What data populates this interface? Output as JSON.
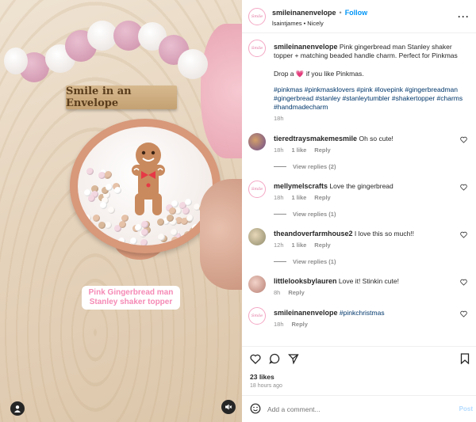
{
  "post": {
    "username": "smileinanenvelope",
    "follow_label": "Follow",
    "separator": "•",
    "audio": "lsaintjames • Nicely",
    "avatar_text": "Smile",
    "caption_intro": "Pink gingerbread man Stanley shaker topper + matching beaded handle charm. Perfect for Pinkmas",
    "caption_drop": "Drop a 💗 if you like Pinkmas.",
    "caption_tags": "#pinkmas #pinkmasklovers #pink #lovepink #gingerbreadman #gingerbread #stanley #stanleytumbler #shakertopper #charms #handmadecharm",
    "caption_time": "18h"
  },
  "media": {
    "plaque_text": "Smile in an Envelope",
    "overlay_caption": "Pink Gingerbread man Stanley shaker topper",
    "profile_icon": "person-icon",
    "mute_icon": "speaker-muted-icon"
  },
  "comments": [
    {
      "user": "tieredtraysmakemesmile",
      "text": "Oh so cute!",
      "time": "18h",
      "likes": "1 like",
      "reply": "Reply",
      "view_replies": "View replies (2)"
    },
    {
      "user": "mellymelscrafts",
      "text": "Love the gingerbread",
      "time": "18h",
      "likes": "1 like",
      "reply": "Reply",
      "view_replies": "View replies (1)"
    },
    {
      "user": "theandoverfarmhouse2",
      "text": "I love this so much!!",
      "time": "12h",
      "likes": "1 like",
      "reply": "Reply",
      "view_replies": "View replies (1)"
    },
    {
      "user": "littlelooksbylauren",
      "text": "Love it! Stinkin cute!",
      "time": "8h",
      "likes": "",
      "reply": "Reply",
      "view_replies": ""
    },
    {
      "user": "smileinanenvelope",
      "text": "#pinkchristmas",
      "time": "18h",
      "likes": "",
      "reply": "Reply",
      "view_replies": ""
    }
  ],
  "actions": {
    "likes_count": "23 likes",
    "posted": "18 hours ago"
  },
  "add_comment": {
    "placeholder": "Add a comment...",
    "post_label": "Post"
  },
  "colors": {
    "accent": "#0095f6",
    "hashtag": "#00376b",
    "caption_pink": "#f58ab5"
  }
}
